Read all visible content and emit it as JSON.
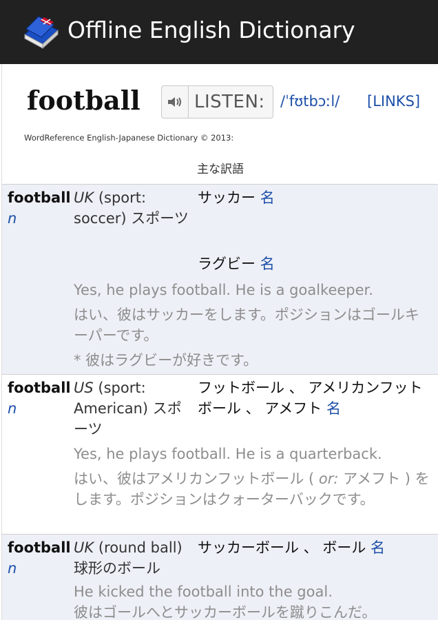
{
  "appbar": {
    "title": "Offline English Dictionary",
    "icon": "dictionary-book-icon",
    "bg_color": "#212121"
  },
  "header": {
    "headword": "football",
    "listen_label": "LISTEN:",
    "pronunciation": "/ˈfʊtbɔːl/",
    "links_label": "[LINKS]",
    "copyright": "WordReference English-Japanese Dictionary © 2013:",
    "section_title": "主な訳語"
  },
  "colors": {
    "link_blue": "#1c4fa8",
    "row_shade": "#eef0f7",
    "example_gray": "#8d8d8d"
  },
  "entries": [
    {
      "word": "football",
      "pos": "n",
      "region": "UK",
      "sense": "(sport: soccer) スポーツ",
      "translations": [
        {
          "text": "サッカー",
          "pos": "名"
        },
        {
          "text": "ラグビー",
          "pos": "名"
        }
      ],
      "example_en": "Yes, he plays football. He is a goalkeeper.",
      "example_ja": "はい、彼はサッカーをします。ポジションはゴールキーパーです。",
      "example_ja2": "* 彼はラグビーが好きです。"
    },
    {
      "word": "football",
      "pos": "n",
      "region": "US",
      "sense": "(sport: American) スポーツ",
      "translations": [
        {
          "text": "フットボール 、 アメリカンフットボール 、 アメフト",
          "pos": "名"
        }
      ],
      "example_en": "Yes, he plays football. He is a quarterback.",
      "example_ja_a": "はい、彼はアメリカンフットボール ( ",
      "example_ja_or": "or:",
      "example_ja_b": " アメフト ) をします。ポジションはクォーターバックです。"
    },
    {
      "word": "football",
      "pos": "n",
      "region": "UK",
      "sense": "(round ball) 球形のボール",
      "translations": [
        {
          "text": "サッカーボール 、 ボール",
          "pos": "名"
        }
      ],
      "example_en": "He kicked the football into the goal.",
      "example_ja": "彼はゴールへとサッカーボールを蹴りこんだ。"
    }
  ]
}
